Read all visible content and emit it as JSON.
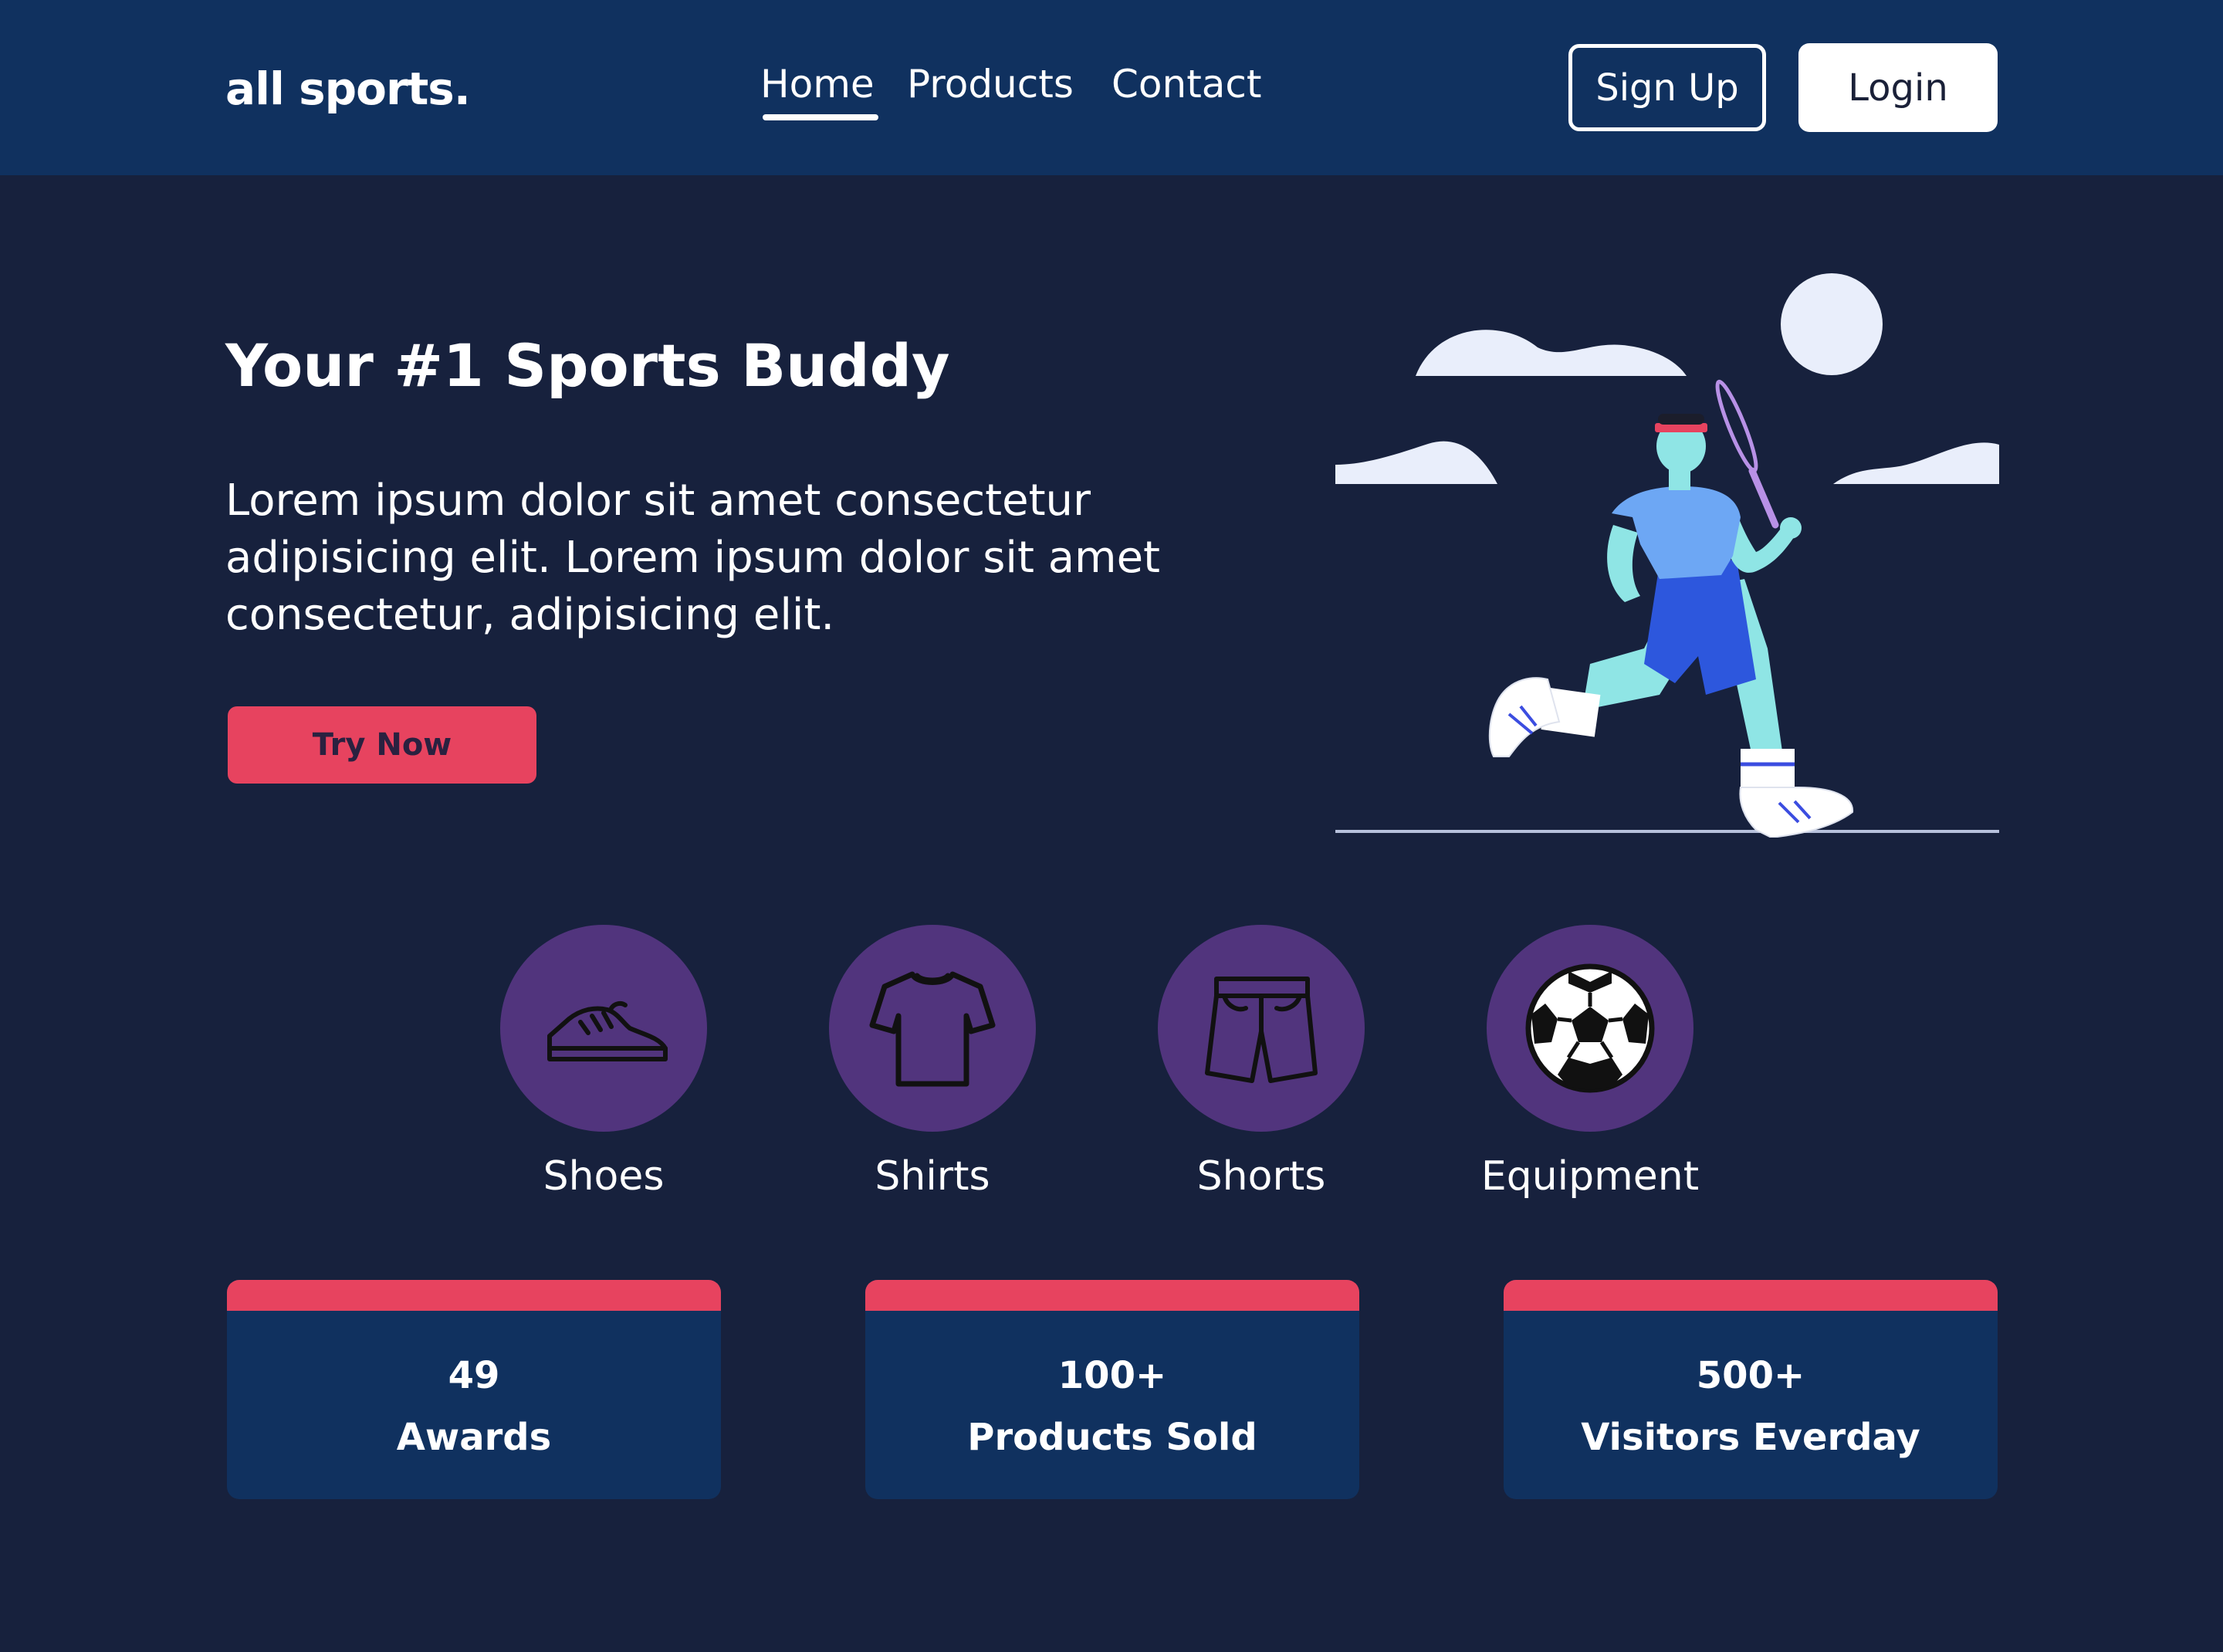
{
  "header": {
    "logo": "all sports.",
    "nav": [
      {
        "label": "Home",
        "active": true
      },
      {
        "label": "Products",
        "active": false
      },
      {
        "label": "Contact",
        "active": false
      }
    ],
    "signup_label": "Sign Up",
    "login_label": "Login"
  },
  "hero": {
    "title": "Your #1 Sports Buddy",
    "description": "Lorem ipsum dolor sit amet consectetur adipisicing elit. Lorem ipsum dolor sit amet consectetur, adipisicing elit.",
    "cta_label": "Try Now"
  },
  "categories": [
    {
      "label": "Shoes",
      "icon": "sneaker-icon"
    },
    {
      "label": "Shirts",
      "icon": "tshirt-icon"
    },
    {
      "label": "Shorts",
      "icon": "shorts-icon"
    },
    {
      "label": "Equipment",
      "icon": "soccer-ball-icon"
    }
  ],
  "stats": [
    {
      "value": "49",
      "label": "Awards"
    },
    {
      "value": "100+",
      "label": "Products Sold"
    },
    {
      "value": "500+",
      "label": "Visitors Everday"
    }
  ],
  "colors": {
    "header_bg": "#10315f",
    "page_bg": "#17213d",
    "accent": "#e7435f",
    "category_circle": "#51347d",
    "card_bg": "#10315f"
  }
}
